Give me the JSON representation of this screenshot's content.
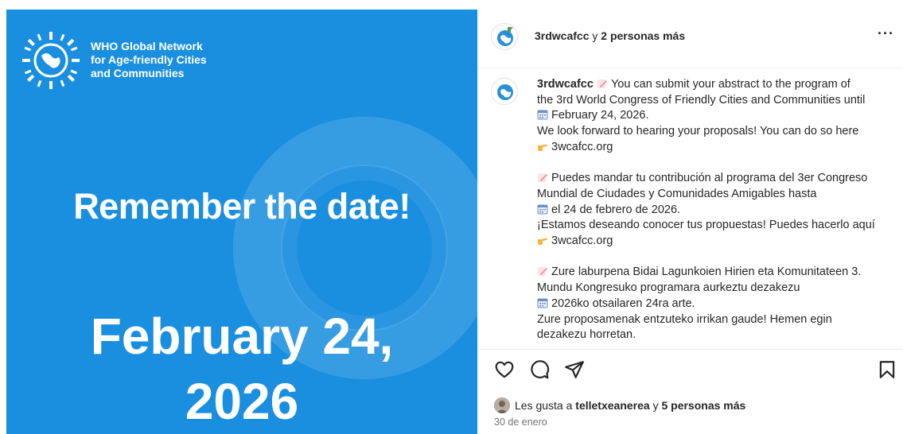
{
  "image": {
    "org_name_lines": [
      "WHO Global Network",
      "for Age-friendly Cities",
      "and Communities"
    ],
    "headline": "Remember the date!",
    "date_line1": "February 24,",
    "date_line2": "2026",
    "background_color": "#1a8fdf"
  },
  "header": {
    "username": "3rdwcafcc",
    "connector": " y ",
    "others": "2 personas más",
    "more_label": "···"
  },
  "caption": {
    "username": "3rdwcafcc",
    "lines": [
      {
        "icon": "memo-icon",
        "text": "You can submit your abstract to the program of"
      },
      {
        "icon": "",
        "text": "the 3rd World Congress of Friendly Cities and Communities until"
      },
      {
        "icon": "calendar-icon",
        "text": "February 24, 2026."
      },
      {
        "icon": "",
        "text": "We look forward to hearing your proposals! You can do so here"
      },
      {
        "icon": "pointing-hand-icon",
        "text": "3wcafcc.org"
      },
      {
        "icon": "gap",
        "text": ""
      },
      {
        "icon": "memo-icon",
        "text": "Puedes mandar tu contribución al programa del 3er Congreso"
      },
      {
        "icon": "",
        "text": "Mundial de Ciudades y Comunidades Amigables hasta"
      },
      {
        "icon": "calendar-icon",
        "text": "el 24 de febrero de 2026."
      },
      {
        "icon": "",
        "text": "¡Estamos deseando conocer tus propuestas! Puedes hacerlo aquí"
      },
      {
        "icon": "pointing-hand-icon",
        "text": "3wcafcc.org"
      },
      {
        "icon": "gap",
        "text": ""
      },
      {
        "icon": "memo-icon",
        "text": "Zure laburpena Bidai Lagunkoien Hirien eta Komunitateen 3."
      },
      {
        "icon": "",
        "text": "Mundu Kongresuko programara aurkeztu dezakezu"
      },
      {
        "icon": "calendar-icon",
        "text": "2026ko otsailaren 24ra arte."
      },
      {
        "icon": "",
        "text": "Zure proposamenak entzuteko irrikan gaude! Hemen egin"
      },
      {
        "icon": "",
        "text": "dezakezu horretan."
      }
    ]
  },
  "likes": {
    "prefix": "Les gusta a ",
    "user": "telletxeanerea",
    "connector": " y ",
    "others": "5 personas más"
  },
  "timestamp": "30 de enero",
  "colors": {
    "emoji_memo": "#f07b8a",
    "emoji_calendar": "#6d8fc7",
    "emoji_hand": "#f4b73d"
  }
}
